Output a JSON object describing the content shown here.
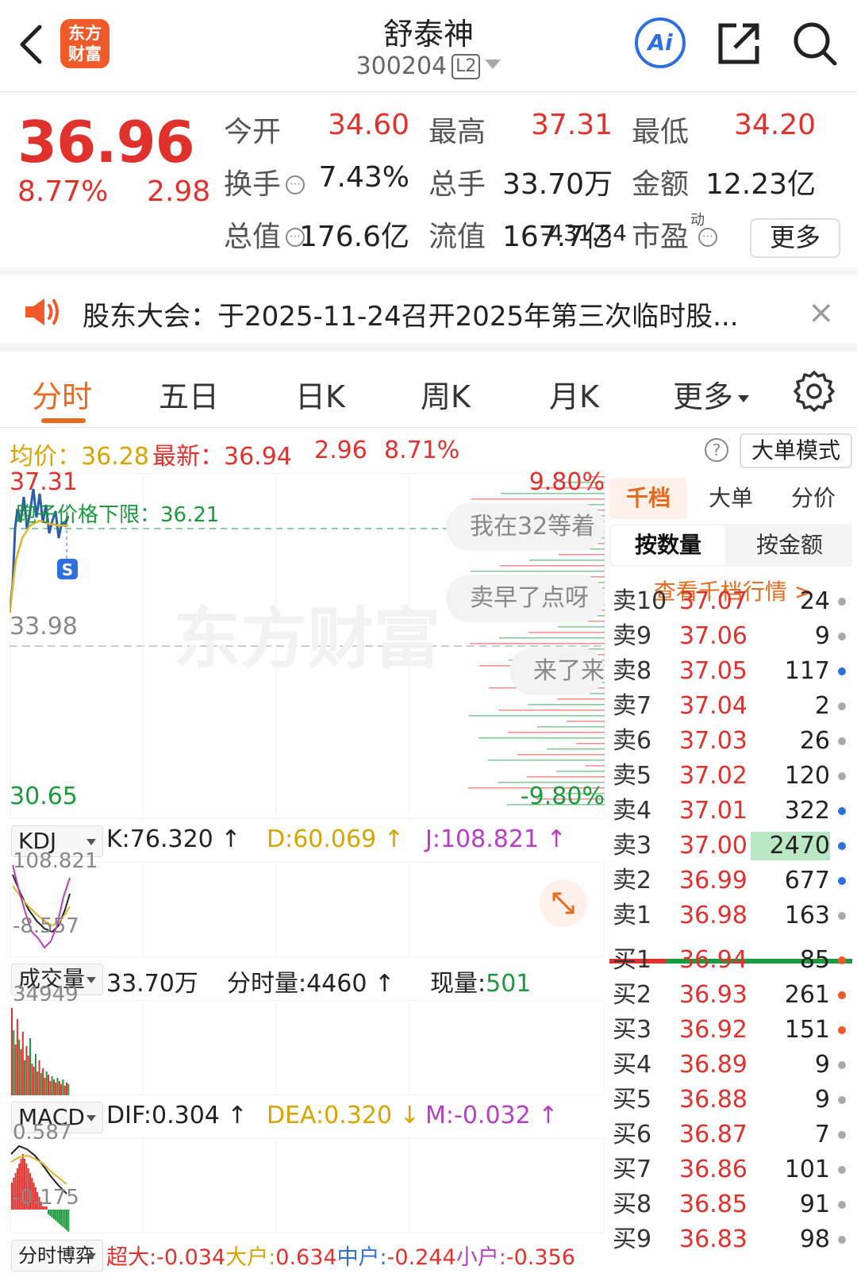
{
  "header": {
    "back": "<",
    "logo_line1": "东方",
    "logo_line2": "财富",
    "stock_name": "舒泰神",
    "stock_code": "300204",
    "level_badge": "L2",
    "ai_label": "Ai"
  },
  "quote": {
    "price": "36.96",
    "pct": "8.77%",
    "chg": "2.98",
    "rows": [
      [
        {
          "label": "今开",
          "value": "34.60",
          "color": "red"
        },
        {
          "label": "最高",
          "value": "37.31",
          "color": "red"
        },
        {
          "label": "最低",
          "value": "34.20",
          "color": "red"
        }
      ],
      [
        {
          "label": "换手",
          "value": "7.43%",
          "color": "dark"
        },
        {
          "label": "总手",
          "value": "33.70万",
          "color": "dark"
        },
        {
          "label": "金额",
          "value": "12.23亿",
          "color": "dark"
        }
      ],
      [
        {
          "label": "总值",
          "value": "176.6亿",
          "color": "dark"
        },
        {
          "label": "流值",
          "value": "167.7亿",
          "color": "dark"
        },
        {
          "label": "市盈",
          "value": "-431.54",
          "color": "dark"
        }
      ]
    ],
    "pe_superscript": "动",
    "more_label": "更多"
  },
  "notice": {
    "text": "股东大会：于2025-11-24召开2025年第三次临时股...",
    "close": "×"
  },
  "tabs": [
    "分时",
    "五日",
    "日K",
    "周K",
    "月K",
    "更多"
  ],
  "avg_row": {
    "avg_label": "均价：36.28",
    "latest_label": "最新：36.94",
    "chg": "2.96",
    "pct": "8.71%",
    "help": "?",
    "bigorder_mode": "大单模式"
  },
  "main_chart": {
    "y_high": "37.31",
    "y_mid": "33.98",
    "y_low": "30.65",
    "pct_high": "9.80%",
    "pct_low": "-9.80%",
    "limit_note": "跑子价格下限：36.21",
    "signal_badge": "S",
    "watermark": "东方财富",
    "bubbles": [
      "我在32等着",
      "卖早了点呀",
      "来了来"
    ]
  },
  "kdj": {
    "selector": "KDJ",
    "k": "K:76.320 ↑",
    "d": "D:60.069 ↑",
    "j": "J:108.821 ↑",
    "top": "108.821",
    "bottom": "-8.557"
  },
  "volume": {
    "selector": "成交量",
    "total": "33.70万",
    "minute_vol": "分时量:4460 ↑",
    "now_label": "现量:",
    "now_value": "501",
    "top": "34949"
  },
  "macd": {
    "selector": "MACD",
    "dif": "DIF:0.304 ↑",
    "dea": "DEA:0.320 ↓",
    "m": "M:-0.032 ↑",
    "top": "0.587",
    "bottom": "-0.175"
  },
  "flow": {
    "selector": "分时博弈",
    "items": [
      {
        "label": "超大:",
        "value": "-0.034",
        "color": "#e0312c"
      },
      {
        "label": "大户:",
        "value": "0.634",
        "color": "#d9a400"
      },
      {
        "label": "中户:",
        "value": "-0.244",
        "color": "#2e6fe0"
      },
      {
        "label": "小户:",
        "value": "-0.356",
        "color": "#b63ec4"
      }
    ]
  },
  "orderbook": {
    "tabs": [
      "千档",
      "大单",
      "分价"
    ],
    "sub_tabs": [
      "按数量",
      "按金额"
    ],
    "link": "查看千档行情 >",
    "asks": [
      {
        "label": "卖10",
        "price": "37.07",
        "vol": "24",
        "dot": "#aaa"
      },
      {
        "label": "卖9",
        "price": "37.06",
        "vol": "9",
        "dot": "#aaa"
      },
      {
        "label": "卖8",
        "price": "37.05",
        "vol": "117",
        "dot": "#2e6fe0"
      },
      {
        "label": "卖7",
        "price": "37.04",
        "vol": "2",
        "dot": "#aaa"
      },
      {
        "label": "卖6",
        "price": "37.03",
        "vol": "26",
        "dot": "#aaa"
      },
      {
        "label": "卖5",
        "price": "37.02",
        "vol": "120",
        "dot": "#aaa"
      },
      {
        "label": "卖4",
        "price": "37.01",
        "vol": "322",
        "dot": "#2e6fe0"
      },
      {
        "label": "卖3",
        "price": "37.00",
        "vol": "2470",
        "dot": "#2e6fe0"
      },
      {
        "label": "卖2",
        "price": "36.99",
        "vol": "677",
        "dot": "#2e6fe0"
      },
      {
        "label": "卖1",
        "price": "36.98",
        "vol": "163",
        "dot": "#aaa"
      }
    ],
    "bids": [
      {
        "label": "买1",
        "price": "36.94",
        "vol": "85",
        "dot": "#f05a28"
      },
      {
        "label": "买2",
        "price": "36.93",
        "vol": "261",
        "dot": "#f05a28"
      },
      {
        "label": "买3",
        "price": "36.92",
        "vol": "151",
        "dot": "#f05a28"
      },
      {
        "label": "买4",
        "price": "36.89",
        "vol": "9",
        "dot": "#aaa"
      },
      {
        "label": "买5",
        "price": "36.88",
        "vol": "9",
        "dot": "#aaa"
      },
      {
        "label": "买6",
        "price": "36.87",
        "vol": "7",
        "dot": "#aaa"
      },
      {
        "label": "买7",
        "price": "36.86",
        "vol": "101",
        "dot": "#aaa"
      },
      {
        "label": "买8",
        "price": "36.85",
        "vol": "91",
        "dot": "#aaa"
      },
      {
        "label": "买9",
        "price": "36.83",
        "vol": "98",
        "dot": "#aaa"
      }
    ]
  },
  "colors": {
    "up": "#e0312c",
    "down": "#1a9a3c",
    "accent": "#e86a1f",
    "avg_line": "#d9a400",
    "price_line": "#2b5ea8"
  }
}
